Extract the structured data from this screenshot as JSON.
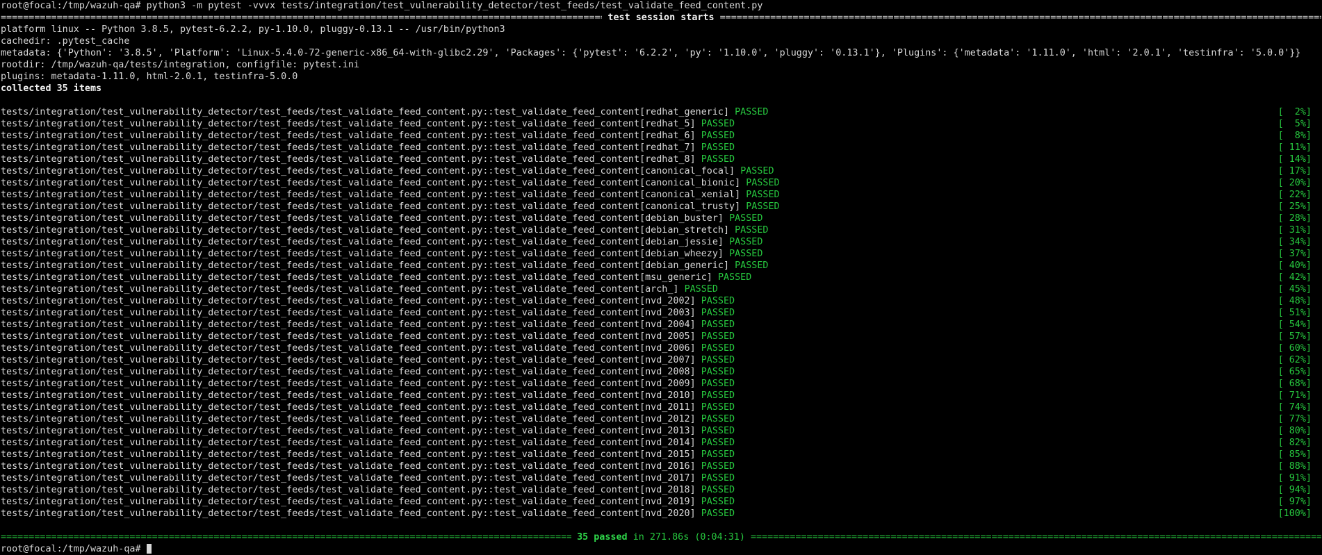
{
  "terminal": {
    "command_line": "root@focal:/tmp/wazuh-qa# python3 -m pytest -vvvx tests/integration/test_vulnerability_detector/test_feeds/test_validate_feed_content.py",
    "session_start_label": "test session starts",
    "info_lines": [
      "platform linux -- Python 3.8.5, pytest-6.2.2, py-1.10.0, pluggy-0.13.1 -- /usr/bin/python3",
      "cachedir: .pytest_cache",
      "metadata: {'Python': '3.8.5', 'Platform': 'Linux-5.4.0-72-generic-x86_64-with-glibc2.29', 'Packages': {'pytest': '6.2.2', 'py': '1.10.0', 'pluggy': '0.13.1'}, 'Plugins': {'metadata': '1.11.0', 'html': '2.0.1', 'testinfra': '5.0.0'}}",
      "rootdir: /tmp/wazuh-qa/tests/integration, configfile: pytest.ini",
      "plugins: metadata-1.11.0, html-2.0.1, testinfra-5.0.0"
    ],
    "collected": "collected 35 items",
    "test_prefix": "tests/integration/test_vulnerability_detector/test_feeds/test_validate_feed_content.py::test_validate_feed_content",
    "status_label": "PASSED",
    "tests": [
      {
        "param": "[redhat_generic]",
        "progress": "[  2%]"
      },
      {
        "param": "[redhat_5]",
        "progress": "[  5%]"
      },
      {
        "param": "[redhat_6]",
        "progress": "[  8%]"
      },
      {
        "param": "[redhat_7]",
        "progress": "[ 11%]"
      },
      {
        "param": "[redhat_8]",
        "progress": "[ 14%]"
      },
      {
        "param": "[canonical_focal]",
        "progress": "[ 17%]"
      },
      {
        "param": "[canonical_bionic]",
        "progress": "[ 20%]"
      },
      {
        "param": "[canonical_xenial]",
        "progress": "[ 22%]"
      },
      {
        "param": "[canonical_trusty]",
        "progress": "[ 25%]"
      },
      {
        "param": "[debian_buster]",
        "progress": "[ 28%]"
      },
      {
        "param": "[debian_stretch]",
        "progress": "[ 31%]"
      },
      {
        "param": "[debian_jessie]",
        "progress": "[ 34%]"
      },
      {
        "param": "[debian_wheezy]",
        "progress": "[ 37%]"
      },
      {
        "param": "[debian_generic]",
        "progress": "[ 40%]"
      },
      {
        "param": "[msu_generic]",
        "progress": "[ 42%]"
      },
      {
        "param": "[arch_]",
        "progress": "[ 45%]"
      },
      {
        "param": "[nvd_2002]",
        "progress": "[ 48%]"
      },
      {
        "param": "[nvd_2003]",
        "progress": "[ 51%]"
      },
      {
        "param": "[nvd_2004]",
        "progress": "[ 54%]"
      },
      {
        "param": "[nvd_2005]",
        "progress": "[ 57%]"
      },
      {
        "param": "[nvd_2006]",
        "progress": "[ 60%]"
      },
      {
        "param": "[nvd_2007]",
        "progress": "[ 62%]"
      },
      {
        "param": "[nvd_2008]",
        "progress": "[ 65%]"
      },
      {
        "param": "[nvd_2009]",
        "progress": "[ 68%]"
      },
      {
        "param": "[nvd_2010]",
        "progress": "[ 71%]"
      },
      {
        "param": "[nvd_2011]",
        "progress": "[ 74%]"
      },
      {
        "param": "[nvd_2012]",
        "progress": "[ 77%]"
      },
      {
        "param": "[nvd_2013]",
        "progress": "[ 80%]"
      },
      {
        "param": "[nvd_2014]",
        "progress": "[ 82%]"
      },
      {
        "param": "[nvd_2015]",
        "progress": "[ 85%]"
      },
      {
        "param": "[nvd_2016]",
        "progress": "[ 88%]"
      },
      {
        "param": "[nvd_2017]",
        "progress": "[ 91%]"
      },
      {
        "param": "[nvd_2018]",
        "progress": "[ 94%]"
      },
      {
        "param": "[nvd_2019]",
        "progress": "[ 97%]"
      },
      {
        "param": "[nvd_2020]",
        "progress": "[100%]"
      }
    ],
    "summary_passed": "35 passed",
    "summary_time": "in 271.86s (0:04:31)",
    "prompt": "root@focal:/tmp/wazuh-qa# "
  },
  "colors": {
    "background": "#000000",
    "foreground": "#d8d8d8",
    "passed": "#27c93f"
  }
}
